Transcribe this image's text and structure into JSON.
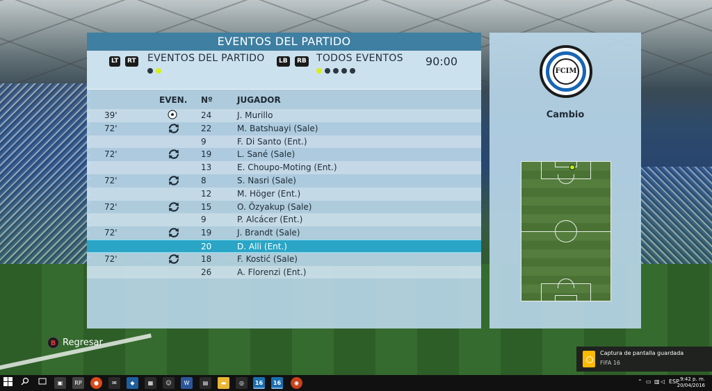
{
  "panel": {
    "title": "EVENTOS DEL PARTIDO",
    "filter_left": {
      "button_a": "LT",
      "button_b": "RT",
      "label": "EVENTOS DEL PARTIDO"
    },
    "filter_right": {
      "button_a": "LB",
      "button_b": "RB",
      "label": "TODOS EVENTOS"
    },
    "clock": "90:00",
    "columns": {
      "event": "EVEN.",
      "number": "Nº",
      "player": "JUGADOR"
    }
  },
  "rows": [
    {
      "minute": "39'",
      "event": "goal",
      "number": "24",
      "player": "J. Murillo"
    },
    {
      "minute": "72'",
      "event": "substitution",
      "number": "22",
      "player": "M. Batshuayi (Sale)"
    },
    {
      "minute": "",
      "event": "",
      "number": "9",
      "player": "F. Di Santo (Ent.)"
    },
    {
      "minute": "72'",
      "event": "substitution",
      "number": "19",
      "player": "L. Sané (Sale)"
    },
    {
      "minute": "",
      "event": "",
      "number": "13",
      "player": "E. Choupo-Moting (Ent.)"
    },
    {
      "minute": "72'",
      "event": "substitution",
      "number": "8",
      "player": "S. Nasri (Sale)"
    },
    {
      "minute": "",
      "event": "",
      "number": "12",
      "player": "M. Höger (Ent.)"
    },
    {
      "minute": "72'",
      "event": "substitution",
      "number": "15",
      "player": "O. Özyakup (Sale)"
    },
    {
      "minute": "",
      "event": "",
      "number": "9",
      "player": "P. Alcácer (Ent.)"
    },
    {
      "minute": "72'",
      "event": "substitution",
      "number": "19",
      "player": "J. Brandt (Sale)"
    },
    {
      "minute": "",
      "event": "",
      "number": "20",
      "player": "D. Alli (Ent.)",
      "selected": true
    },
    {
      "minute": "72'",
      "event": "substitution",
      "number": "18",
      "player": "F. Kostić (Sale)"
    },
    {
      "minute": "",
      "event": "",
      "number": "26",
      "player": "A. Florenzi (Ent.)"
    }
  ],
  "team": {
    "logo_text": "FCIM",
    "event_type": "Cambio"
  },
  "back": {
    "button": "B",
    "label": "Regresar"
  },
  "toast": {
    "title": "Captura de pantalla guardada",
    "app": "FIFA 16"
  },
  "taskbar": {
    "time": "9:42 p. m.",
    "date": "20/04/2016",
    "lang": "ESP",
    "app_badge_1": "16",
    "app_badge_2": "16",
    "rp_label": "RP"
  },
  "colors": {
    "accent": "#3e7fa2",
    "selected_row": "#2aa5c6",
    "dot_active": "#d7ef1a"
  }
}
